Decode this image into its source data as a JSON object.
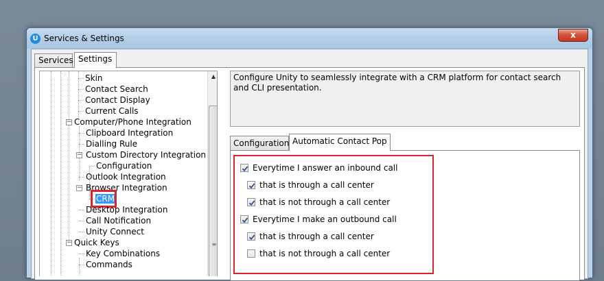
{
  "window": {
    "title": "Services & Settings",
    "app_icon_letter": "U",
    "close_glyph": "x"
  },
  "tabs": [
    {
      "label": "Services",
      "active": false
    },
    {
      "label": "Settings",
      "active": true
    }
  ],
  "tree": {
    "items": [
      {
        "label": "Skin"
      },
      {
        "label": "Contact Search"
      },
      {
        "label": "Contact Display"
      },
      {
        "label": "Current Calls"
      },
      {
        "label": "Computer/Phone Integration",
        "expanded": true
      },
      {
        "label": "Clipboard Integration"
      },
      {
        "label": "Dialling Rule"
      },
      {
        "label": "Custom Directory Integration",
        "expanded": true
      },
      {
        "label": "Configuration"
      },
      {
        "label": "Outlook Integration"
      },
      {
        "label": "Browser Integration",
        "expanded": true
      },
      {
        "label": "CRM",
        "selected": true
      },
      {
        "label": "Desktop Integration"
      },
      {
        "label": "Call Notification"
      },
      {
        "label": "Unity Connect"
      },
      {
        "label": "Quick Keys",
        "expanded": true
      },
      {
        "label": "Key Combinations"
      },
      {
        "label": "Commands"
      }
    ],
    "expander_glyph": "−",
    "scroll_up_glyph": "▲",
    "grip_glyph": "≡"
  },
  "description": "Configure Unity to seamlessly integrate with a CRM platform for contact search and CLI presentation.",
  "inner_tabs": [
    {
      "label": "Configuration",
      "active": false
    },
    {
      "label": "Automatic Contact Pop",
      "active": true
    }
  ],
  "options": [
    {
      "label": "Everytime I answer an inbound call",
      "checked": true
    },
    {
      "label": "that is through a call center",
      "checked": true
    },
    {
      "label": "that is not through a call center",
      "checked": true
    },
    {
      "label": "Everytime I make an outbound call",
      "checked": true
    },
    {
      "label": "that is through a call center",
      "checked": true
    },
    {
      "label": "that is not through a call center",
      "checked": false
    }
  ],
  "colors": {
    "highlight": "#d9232f",
    "selection": "#3399ff"
  }
}
